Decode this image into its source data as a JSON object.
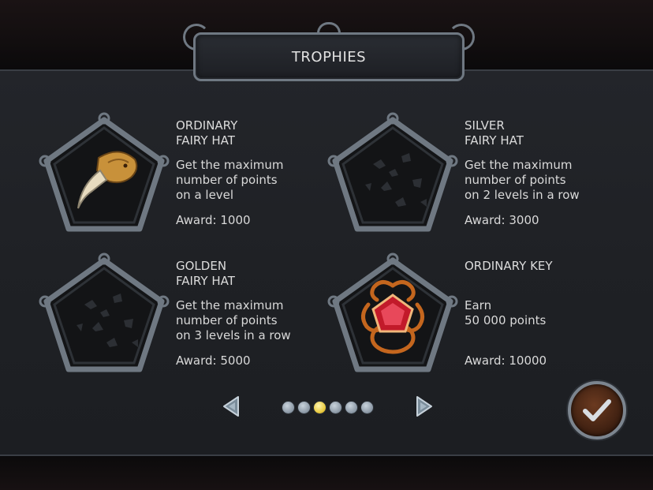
{
  "header": {
    "title": "TROPHIES"
  },
  "trophies": [
    {
      "name": "ORDINARY\nFAIRY HAT",
      "desc": [
        "Get the maximum",
        "number of points",
        "on a level"
      ],
      "award": "Award: 1000",
      "icon": "fang-icon",
      "unlocked": true
    },
    {
      "name": "SILVER\nFAIRY HAT",
      "desc": [
        "Get the maximum",
        "number of points",
        "on 2 levels in a row"
      ],
      "award": "Award: 3000",
      "icon": "locked-trophy-icon",
      "unlocked": false
    },
    {
      "name": "GOLDEN\nFAIRY HAT",
      "desc": [
        "Get the maximum",
        "number of points",
        "on 3 levels in a row"
      ],
      "award": "Award: 5000",
      "icon": "locked-trophy-icon",
      "unlocked": false
    },
    {
      "name": "ORDINARY KEY",
      "desc": [
        "Earn",
        "50 000 points"
      ],
      "award": "Award: 10000",
      "icon": "ruby-key-icon",
      "unlocked": true
    }
  ],
  "pagination": {
    "pages": 6,
    "current": 3
  },
  "colors": {
    "panel": "#202227",
    "frame": "#6f7882",
    "active_dot": "#e8c83c",
    "ok_button": "#4a2614"
  }
}
